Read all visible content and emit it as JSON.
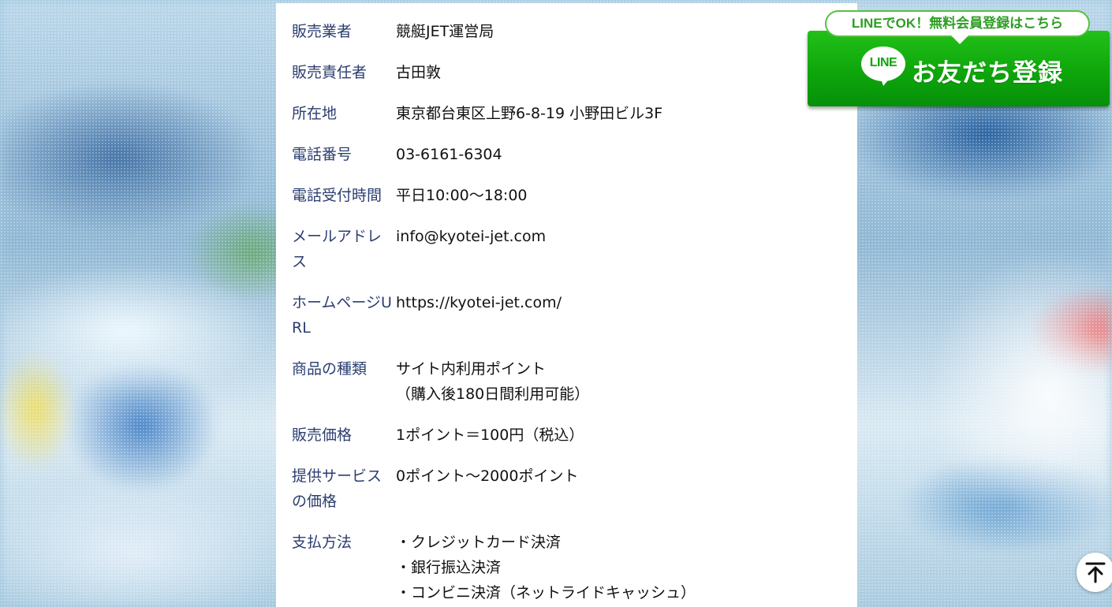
{
  "company_info": {
    "rows": [
      {
        "label": "販売業者",
        "value": [
          "競艇JET運営局"
        ]
      },
      {
        "label": "販売責任者",
        "value": [
          "古田敦"
        ]
      },
      {
        "label": "所在地",
        "value": [
          "東京都台東区上野6-8-19 小野田ビル3F"
        ]
      },
      {
        "label": "電話番号",
        "value": [
          "03-6161-6304"
        ]
      },
      {
        "label": "電話受付時間",
        "value": [
          "平日10:00～18:00"
        ]
      },
      {
        "label": "メールアドレス",
        "value": [
          "info@kyotei-jet.com"
        ]
      },
      {
        "label": "ホームページURL",
        "value": [
          "https://kyotei-jet.com/"
        ]
      },
      {
        "label": "商品の種類",
        "value": [
          "サイト内利用ポイント",
          "（購入後180日間利用可能）"
        ]
      },
      {
        "label": "販売価格",
        "value": [
          "1ポイント＝100円（税込）"
        ]
      },
      {
        "label": "提供サービスの価格",
        "value": [
          "0ポイント～2000ポイント"
        ]
      },
      {
        "label": "支払方法",
        "value": [
          "・クレジットカード決済",
          "・銀行振込決済",
          "・コンビニ決済（ネットライドキャッシュ）"
        ]
      }
    ]
  },
  "line_banner": {
    "bubble_text": "LINEでOK！無料会員登録はこちら",
    "logo_text": "LINE",
    "cta_text": "お友だち登録",
    "accent_color": "#0ea60b"
  },
  "back_to_top": {
    "icon": "arrow-up-to-line-icon"
  }
}
